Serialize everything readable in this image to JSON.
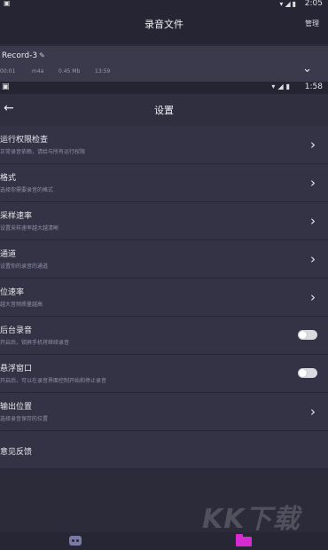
{
  "back_screen": {
    "status": {
      "left": "▣",
      "time": "2:05"
    },
    "title": "录音文件",
    "manage_label": "管理",
    "record": {
      "name": "Record-3",
      "edit_icon": "edit-icon",
      "meta": [
        "00:01",
        "m4a",
        "0.45 Mb",
        "13:59"
      ]
    }
  },
  "status": {
    "left": "▣",
    "time": "1:58"
  },
  "header": {
    "title": "设置"
  },
  "settings": [
    {
      "label": "运行权限检查",
      "desc": "正常录音依赖，请给与所有运行权限",
      "control": "arrow"
    },
    {
      "label": "格式",
      "desc": "选择你需要录音的格式",
      "control": "arrow"
    },
    {
      "label": "采样速率",
      "desc": "设置采样速率越大越清晰",
      "control": "arrow"
    },
    {
      "label": "通道",
      "desc": "设置你的录音的通道",
      "control": "arrow"
    },
    {
      "label": "位速率",
      "desc": "越大音频质量越高",
      "control": "arrow"
    },
    {
      "label": "后台录音",
      "desc": "开启后，锁屏手机将继续录音",
      "control": "toggle",
      "on": false
    },
    {
      "label": "悬浮窗口",
      "desc": "开启后，可以在录音界面控制开始和停止录音",
      "control": "toggle",
      "on": false
    },
    {
      "label": "输出位置",
      "desc": "选择录音保存的位置",
      "control": "arrow"
    },
    {
      "label": "意见反馈",
      "desc": "",
      "control": "none"
    }
  ],
  "watermark": "KK下载",
  "colors": {
    "accent": "#d62bd0",
    "background": "#2b2b3a",
    "row": "#333345"
  }
}
